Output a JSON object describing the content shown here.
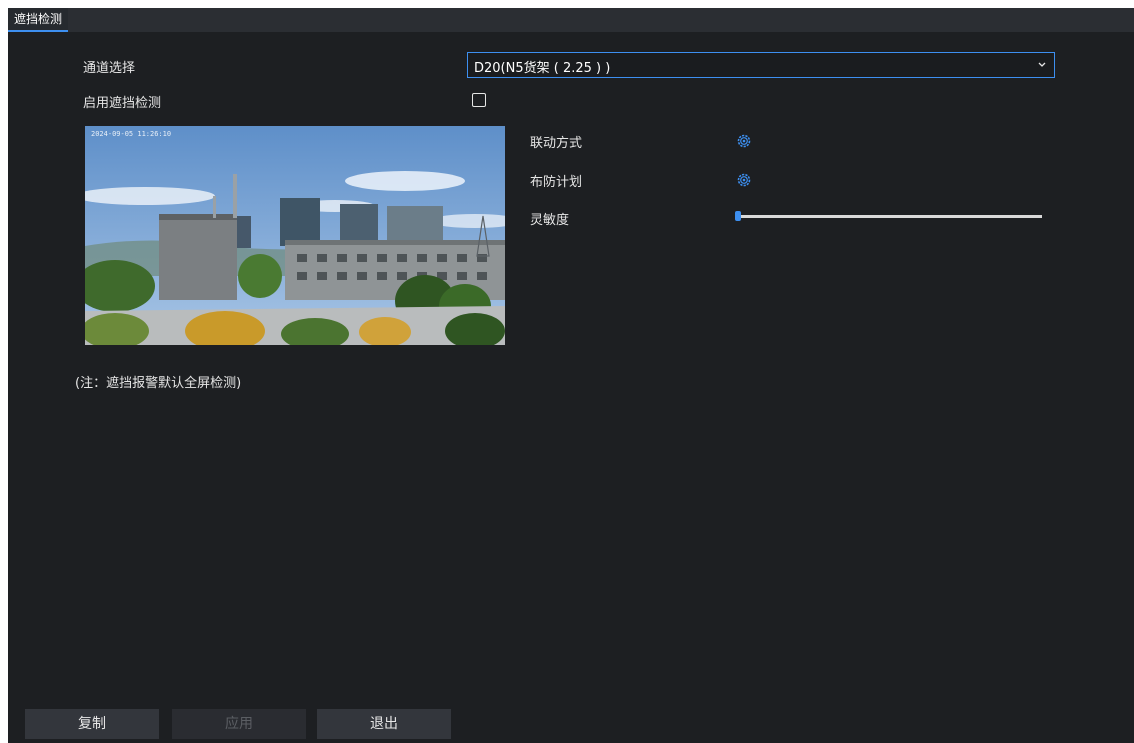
{
  "tab": {
    "label": "遮挡检测"
  },
  "form": {
    "channel_label": "通道选择",
    "channel_value": "D20(N5货架 ( 2.25 ) )",
    "enable_label": "启用遮挡检测",
    "enable_checked": false,
    "linkage_label": "联动方式",
    "schedule_label": "布防计划",
    "sensitivity_label": "灵敏度",
    "sensitivity_level": 0,
    "note": "(注：遮挡报警默认全屏检测)"
  },
  "preview": {
    "osd_text": "2024-09-05 11:26:10"
  },
  "buttons": {
    "copy": "复制",
    "apply": "应用",
    "exit": "退出"
  },
  "icons": {
    "linkage": "gear-icon",
    "schedule": "gear-icon",
    "dropdown": "chevron-down-icon"
  },
  "colors": {
    "accent": "#3d8ff0",
    "background": "#1d1f22",
    "tabbar": "#2b2e33"
  }
}
